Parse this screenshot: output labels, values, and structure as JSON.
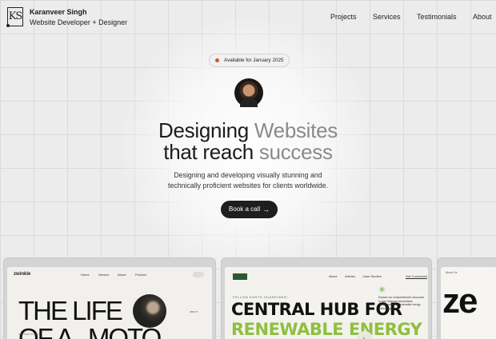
{
  "header": {
    "logo_text": "KS",
    "name": "Karanveer Singh",
    "role": "Website Developer + Designer",
    "nav": [
      "Projects",
      "Services",
      "Testimonials",
      "About"
    ]
  },
  "hero": {
    "availability": "Available for January 2025",
    "headline_line1_a": "Designing ",
    "headline_line1_b": "Websites",
    "headline_line2_a": "that reach ",
    "headline_line2_b": "success",
    "sub_line1": "Designing and developing visually stunning and",
    "sub_line2": "technically proficient websites for clients worldwide.",
    "cta_label": "Book a call",
    "cta_icon": "→"
  },
  "mockups": {
    "m1": {
      "logo": "zwinkle",
      "nav": [
        "Home",
        "Service",
        "About",
        "Product"
      ],
      "line1": "THE LIFE",
      "line2": "OF A   MOTO",
      "small": "CUSTOM TO LIFE",
      "tag": "ABOUT"
    },
    "m2": {
      "nav": [
        "About",
        "Articles",
        "Case Studies",
        "Get Connected"
      ],
      "eyebrow": "FELLOW EARTH GUARDIANS!",
      "line1": "CENTRAL HUB FOR",
      "line2": "RENEWABLE ENERGY",
      "star": "✳",
      "para": "Explore our comprehensive resources to stay informed about latest developments in renewable energy technologies.",
      "arrow": "↘"
    },
    "m3": {
      "nav": "About Us",
      "big": "ze"
    }
  },
  "colors": {
    "accent_dot": "#c85a2a",
    "cta_bg": "#1e1e1e",
    "green": "#8fbf3f"
  }
}
